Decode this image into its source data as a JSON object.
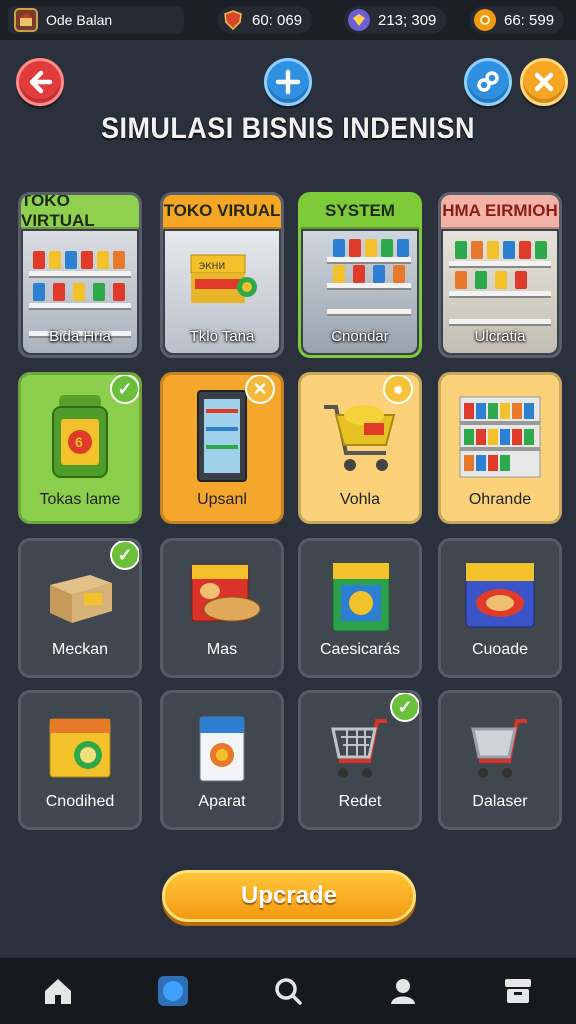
{
  "player": {
    "name": "Ode Balan",
    "avatar_icon": "shop-avatar-icon"
  },
  "resources": [
    {
      "icon": "shield-icon",
      "value": "60: 069",
      "color": "#d8472c"
    },
    {
      "icon": "gem-icon",
      "value": "213; 309",
      "color": "#6c5ed4"
    },
    {
      "icon": "coin-icon",
      "value": "66: 599",
      "color": "#f29a12"
    }
  ],
  "header": {
    "back_icon": "arrow-left-icon",
    "add_icon": "plus-icon",
    "link_icon": "link-icon",
    "close_icon": "close-icon",
    "title": "SIMULASI BISNIS INDENISN"
  },
  "shop_cards": [
    {
      "tag": "TOKO VIRTUAL",
      "caption": "Bida Hria",
      "tag_color": "#8fd14f"
    },
    {
      "tag": "TOKO VIRUAL",
      "caption": "Tklo Tana",
      "tag_color": "#f6a623"
    },
    {
      "tag": "SYSTEM",
      "caption": "Cnondar",
      "tag_color": "#7ecb3a"
    },
    {
      "tag": "HMA EIRMIOH",
      "caption": "Ulcratia",
      "tag_color": "#f4b3a8"
    }
  ],
  "category_cards": [
    {
      "caption": "Tokas lame",
      "badge": "✓",
      "color": "#8ccf4c"
    },
    {
      "caption": "Upsanl",
      "badge": "✕",
      "color": "#f5a62c"
    },
    {
      "caption": "Vohla",
      "badge": "●",
      "color": "#fbd27a"
    },
    {
      "caption": "Ohrande",
      "badge": "",
      "color": "#fbd27a"
    }
  ],
  "item_cards": [
    {
      "caption": "Meckan",
      "icon": "box-icon",
      "checked": true
    },
    {
      "caption": "Mas",
      "icon": "bread-box-icon",
      "checked": false
    },
    {
      "caption": "Caesicarás",
      "icon": "package-icon",
      "checked": false
    },
    {
      "caption": "Cuoade",
      "icon": "snack-box-icon",
      "checked": false
    },
    {
      "caption": "Cnodihed",
      "icon": "juice-box-icon",
      "checked": false
    },
    {
      "caption": "Aparat",
      "icon": "carton-icon",
      "checked": false
    },
    {
      "caption": "Redet",
      "icon": "cart-icon",
      "checked": true
    },
    {
      "caption": "Dalaser",
      "icon": "cart-icon",
      "checked": false
    }
  ],
  "upgrade_label": "Upcrade",
  "nav": [
    "home-icon",
    "circle-icon",
    "search-icon",
    "profile-icon",
    "inventory-icon"
  ]
}
